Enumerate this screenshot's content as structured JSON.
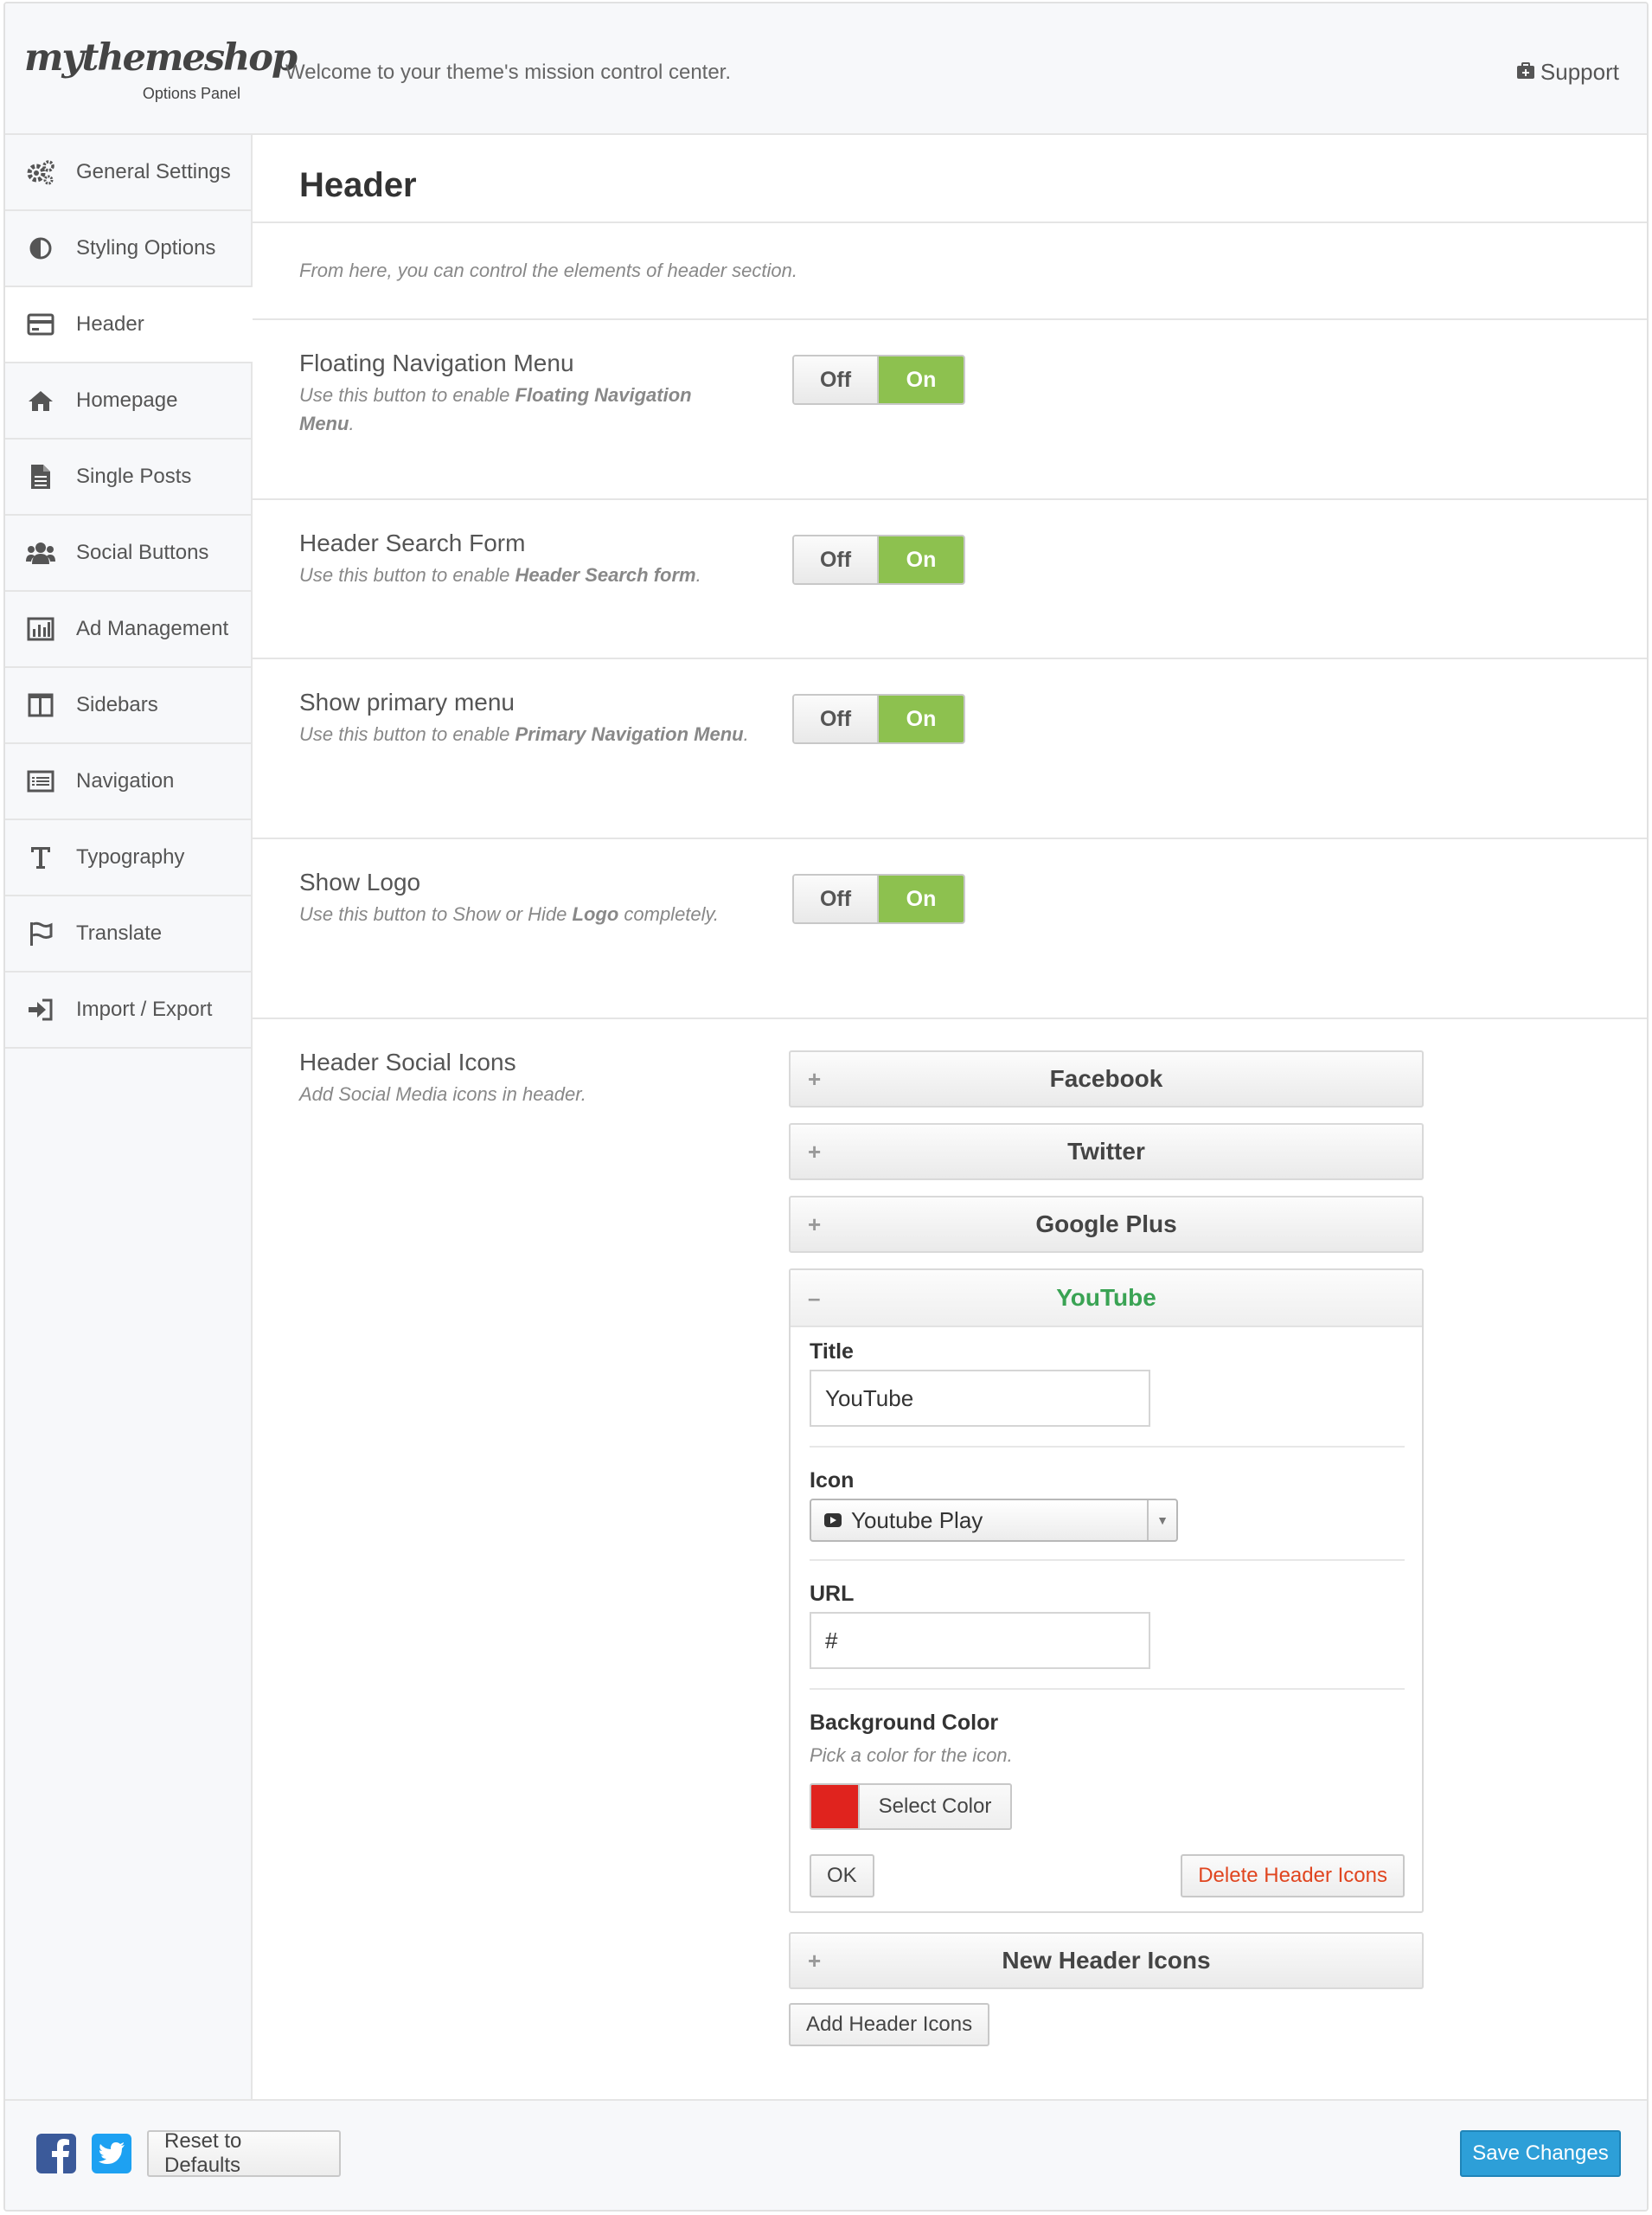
{
  "header": {
    "logo_text": "mythemeshop",
    "logo_sub": "Options Panel",
    "welcome": "Welcome to your theme's mission control center.",
    "support_label": "Support",
    "support_icon": "medkit-icon"
  },
  "sidebar": {
    "items": [
      {
        "label": "General Settings",
        "icon": "gears-icon",
        "active": false
      },
      {
        "label": "Styling Options",
        "icon": "contrast-icon",
        "active": false
      },
      {
        "label": "Header",
        "icon": "credit-card-icon",
        "active": true
      },
      {
        "label": "Homepage",
        "icon": "home-icon",
        "active": false
      },
      {
        "label": "Single Posts",
        "icon": "file-icon",
        "active": false
      },
      {
        "label": "Social Buttons",
        "icon": "users-icon",
        "active": false
      },
      {
        "label": "Ad Management",
        "icon": "bar-chart-icon",
        "active": false
      },
      {
        "label": "Sidebars",
        "icon": "columns-icon",
        "active": false
      },
      {
        "label": "Navigation",
        "icon": "list-icon",
        "active": false
      },
      {
        "label": "Typography",
        "icon": "text-icon",
        "active": false
      },
      {
        "label": "Translate",
        "icon": "flag-icon",
        "active": false
      },
      {
        "label": "Import / Export",
        "icon": "sign-in-icon",
        "active": false
      }
    ]
  },
  "main": {
    "title": "Header",
    "description": "From here, you can control the elements of header section.",
    "options": [
      {
        "title": "Floating Navigation Menu",
        "sub_pre": "Use this button to enable ",
        "sub_bold": "Floating Navigation Menu",
        "sub_post": ".",
        "off": "Off",
        "on": "On",
        "value": "On"
      },
      {
        "title": "Header Search Form",
        "sub_pre": "Use this button to enable ",
        "sub_bold": "Header Search form",
        "sub_post": ".",
        "off": "Off",
        "on": "On",
        "value": "On"
      },
      {
        "title": "Show primary menu",
        "sub_pre": "Use this button to enable ",
        "sub_bold": "Primary Navigation Menu",
        "sub_post": ".",
        "off": "Off",
        "on": "On",
        "value": "On"
      },
      {
        "title": "Show Logo",
        "sub_pre": "Use this button to Show or Hide ",
        "sub_bold": "Logo",
        "sub_post": " completely.",
        "off": "Off",
        "on": "On",
        "value": "On"
      }
    ],
    "social": {
      "title": "Header Social Icons",
      "subtitle": "Add Social Media icons in header.",
      "collapsed_sign": "+",
      "expanded_sign": "–",
      "items": [
        "Facebook",
        "Twitter",
        "Google Plus"
      ],
      "open_item": {
        "header": "YouTube",
        "title_label": "Title",
        "title_value": "YouTube",
        "icon_label": "Icon",
        "icon_value": "Youtube Play",
        "icon_name": "youtube-play-icon",
        "url_label": "URL",
        "url_value": "#",
        "bg_label": "Background Color",
        "bg_hint": "Pick a color for the icon.",
        "bg_color": "#e0231e",
        "select_color": "Select Color",
        "ok": "OK",
        "delete": "Delete Header Icons"
      },
      "new_item": "New Header Icons",
      "add_button": "Add Header Icons"
    }
  },
  "footer": {
    "facebook_icon": "facebook-icon",
    "twitter_icon": "twitter-icon",
    "reset": "Reset to Defaults",
    "save": "Save Changes"
  },
  "colors": {
    "toggle_on": "#8dc14f",
    "accent_green": "#3aa354",
    "save_blue": "#2d9fd8",
    "delete_red": "#e0451f"
  }
}
